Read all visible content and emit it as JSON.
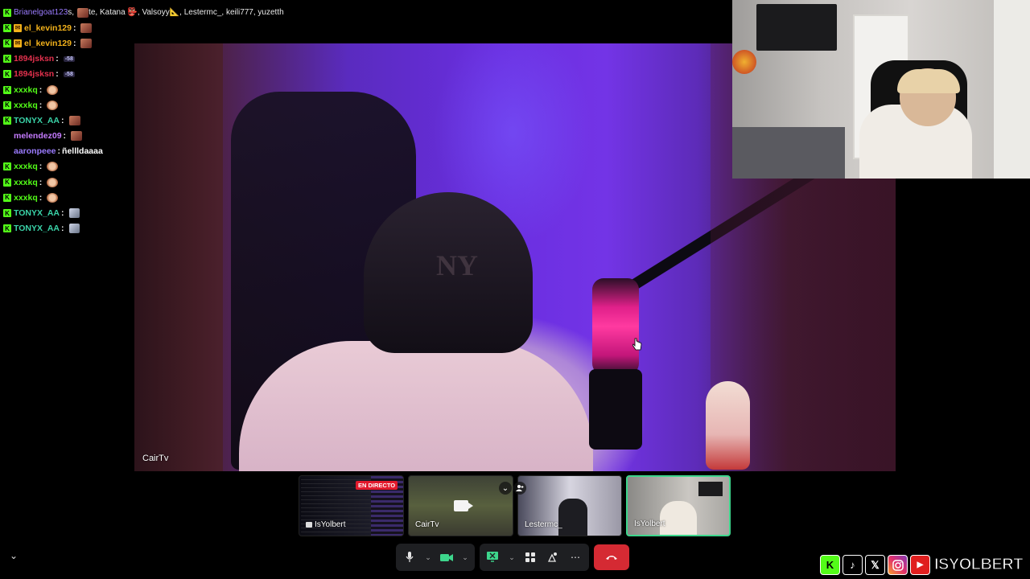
{
  "chat": {
    "top_line": {
      "user": "Brianelgoat123",
      "text": "s, ",
      "names": "te, Katana 👺, Valsoyy📐, Lestermc_, keili777, yuzetth"
    },
    "messages": [
      {
        "user": "el_kevin129",
        "color": "#f3b21b",
        "badges": [
          "kick",
          "gold"
        ],
        "emote": "pepe",
        "text": ""
      },
      {
        "user": "el_kevin129",
        "color": "#f3b21b",
        "badges": [
          "kick",
          "gold"
        ],
        "emote": "pepe",
        "text": ""
      },
      {
        "user": "1894jsksn",
        "color": "#e2314d",
        "badges": [
          "kick"
        ],
        "chip": "-58",
        "text": ""
      },
      {
        "user": "1894jsksn",
        "color": "#e2314d",
        "badges": [
          "kick"
        ],
        "chip": "-58",
        "text": ""
      },
      {
        "user": "xxxkq",
        "color": "#53fc18",
        "badges": [
          "kick"
        ],
        "emote": "sad",
        "text": ""
      },
      {
        "user": "xxxkq",
        "color": "#53fc18",
        "badges": [
          "kick"
        ],
        "emote": "sad",
        "text": ""
      },
      {
        "user": "TONYX_AA",
        "color": "#3ad3a8",
        "badges": [
          "kick"
        ],
        "emote": "pepe",
        "text": ""
      },
      {
        "user": "melendez09",
        "color": "#c57bff",
        "badges": [],
        "emote": "pepe",
        "text": ""
      },
      {
        "user": "aaronpeee",
        "color": "#9b7bff",
        "badges": [],
        "text": "ñellldaaaa"
      },
      {
        "user": "xxxkq",
        "color": "#53fc18",
        "badges": [
          "kick"
        ],
        "emote": "sad",
        "text": ""
      },
      {
        "user": "xxxkq",
        "color": "#53fc18",
        "badges": [
          "kick"
        ],
        "emote": "sad",
        "text": ""
      },
      {
        "user": "xxxkq",
        "color": "#53fc18",
        "badges": [
          "kick"
        ],
        "emote": "sad",
        "text": ""
      },
      {
        "user": "TONYX_AA",
        "color": "#3ad3a8",
        "badges": [
          "kick"
        ],
        "emote": "sat",
        "text": ""
      },
      {
        "user": "TONYX_AA",
        "color": "#3ad3a8",
        "badges": [
          "kick"
        ],
        "emote": "sat",
        "text": ""
      }
    ]
  },
  "main_video": {
    "name": "CairTv"
  },
  "thumbnails": [
    {
      "name": "IsYolbert",
      "live_badge": "EN DIRECTO",
      "icon": "screen-share-icon"
    },
    {
      "name": "CairTv",
      "icon": "camera-off-icon"
    },
    {
      "name": "Lestermc_"
    },
    {
      "name": "IsYolbert",
      "active": true
    }
  ],
  "controls": {
    "mic": "microphone-icon",
    "camera": "camera-icon",
    "screen_share": "screen-share-icon",
    "activities": "activities-icon",
    "soundboard": "soundboard-icon",
    "more": "⋯",
    "end_call": "end-call-icon"
  },
  "social": {
    "icons": [
      "kick-icon",
      "tiktok-icon",
      "x-icon",
      "instagram-icon",
      "youtube-icon"
    ],
    "handle": "ISYOLBERT"
  },
  "colors": {
    "kick_green": "#53fc18",
    "end_call_red": "#d52a33",
    "live_red": "#e2192c",
    "active_border": "#3dd68c"
  }
}
